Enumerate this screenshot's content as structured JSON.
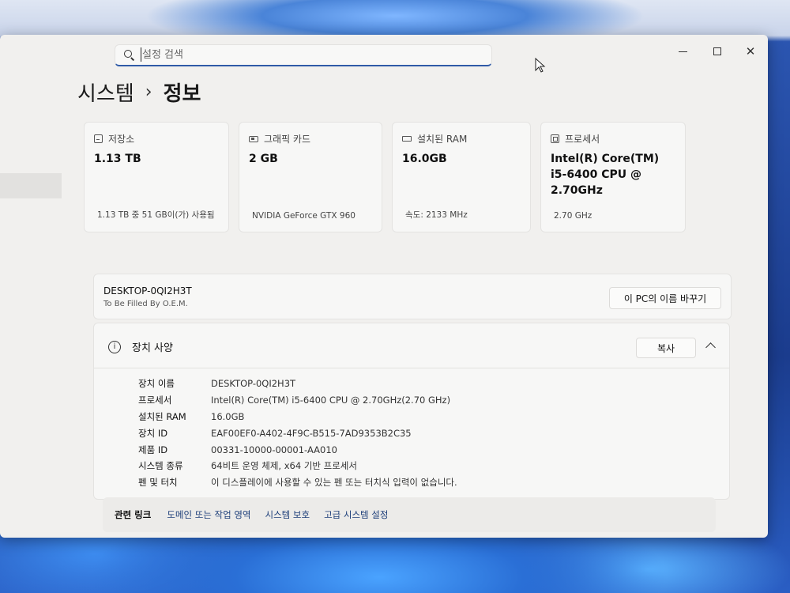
{
  "search": {
    "placeholder": "설정 검색"
  },
  "window_controls": {
    "minimize": "minimize",
    "maximize": "maximize",
    "close": "✕"
  },
  "breadcrumb": {
    "parent": "시스템",
    "separator": "›",
    "current": "정보"
  },
  "cards": [
    {
      "icon": "storage-icon",
      "label": "저장소",
      "value": "1.13 TB",
      "sub": "1.13 TB 중 51 GB이(가) 사용됨"
    },
    {
      "icon": "graphics-card-icon",
      "label": "그래픽 카드",
      "value": "2 GB",
      "sub": "NVIDIA GeForce GTX 960"
    },
    {
      "icon": "ram-icon",
      "label": "설치된 RAM",
      "value": "16.0GB",
      "sub": "속도: 2133 MHz"
    },
    {
      "icon": "processor-icon",
      "label": "프로세서",
      "value": "Intel(R) Core(TM) i5-6400 CPU @ 2.70GHz",
      "sub": "2.70 GHz"
    }
  ],
  "device": {
    "name": "DESKTOP-0QI2H3T",
    "model": "To Be Filled By O.E.M.",
    "rename_label": "이 PC의 이름 바꾸기"
  },
  "specs": {
    "title": "장치 사양",
    "copy_label": "복사",
    "rows": [
      {
        "key": "장치 이름",
        "value": "DESKTOP-0QI2H3T"
      },
      {
        "key": "프로세서",
        "value": "Intel(R) Core(TM) i5-6400 CPU @ 2.70GHz(2.70 GHz)"
      },
      {
        "key": "설치된 RAM",
        "value": "16.0GB"
      },
      {
        "key": "장치 ID",
        "value": "EAF00EF0-A402-4F9C-B515-7AD9353B2C35"
      },
      {
        "key": "제품 ID",
        "value": "00331-10000-00001-AA010"
      },
      {
        "key": "시스템 종류",
        "value": "64비트 운영 체제, x64 기반 프로세서"
      },
      {
        "key": "펜 및 터치",
        "value": "이 디스플레이에 사용할 수 있는 펜 또는 터치식 입력이 없습니다."
      }
    ]
  },
  "related": {
    "label": "관련 링크",
    "links": [
      "도메인 또는 작업 영역",
      "시스템 보호",
      "고급 시스템 설정"
    ]
  }
}
